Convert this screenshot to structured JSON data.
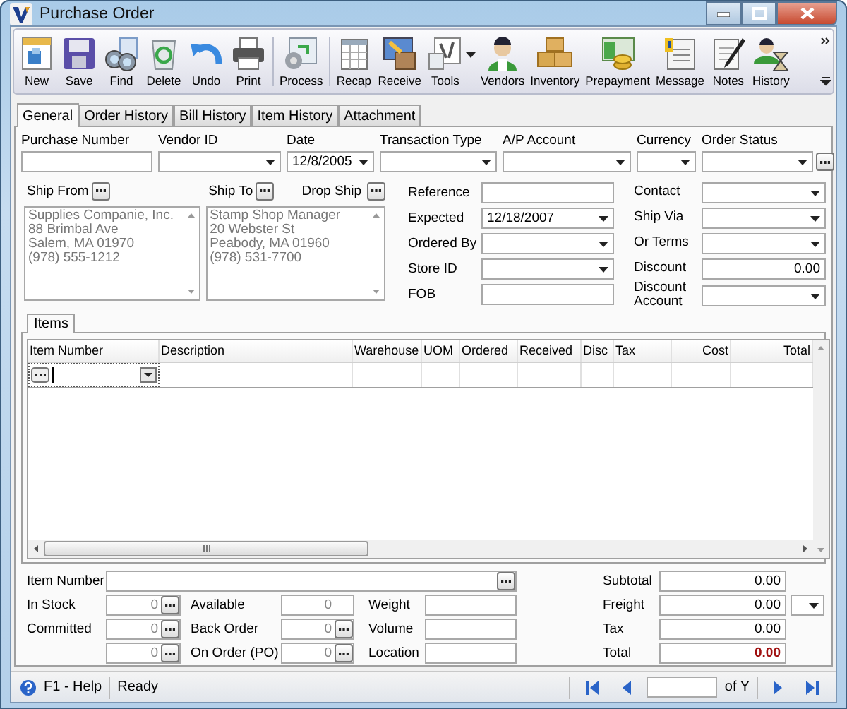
{
  "window": {
    "title": "Purchase Order"
  },
  "toolbar_groups": [
    [
      {
        "label": "New",
        "dropdown": false
      },
      {
        "label": "Save",
        "dropdown": false
      },
      {
        "label": "Find",
        "dropdown": false
      },
      {
        "label": "Delete",
        "dropdown": false
      },
      {
        "label": "Undo",
        "dropdown": false
      },
      {
        "label": "Print",
        "dropdown": false
      }
    ],
    [
      {
        "label": "Process",
        "dropdown": false
      }
    ],
    [
      {
        "label": "Recap",
        "dropdown": false
      },
      {
        "label": "Receive",
        "dropdown": false
      },
      {
        "label": "Tools",
        "dropdown": true
      },
      {
        "label": "Vendors",
        "dropdown": false
      },
      {
        "label": "Inventory",
        "dropdown": false
      },
      {
        "label": "Prepayment",
        "dropdown": false
      },
      {
        "label": "Message",
        "dropdown": false
      },
      {
        "label": "Notes",
        "dropdown": false
      },
      {
        "label": "History",
        "dropdown": false
      }
    ]
  ],
  "tabs": [
    {
      "label": "General",
      "selected": true
    },
    {
      "label": "Order History",
      "selected": false
    },
    {
      "label": "Bill History",
      "selected": false
    },
    {
      "label": "Item History",
      "selected": false
    },
    {
      "label": "Attachment",
      "selected": false
    }
  ],
  "header_fields": [
    {
      "label": "Purchase Number",
      "kind": "text"
    },
    {
      "label": "Vendor ID",
      "kind": "combo"
    },
    {
      "label": "Date",
      "kind": "combo",
      "value": "12/8/2005"
    },
    {
      "label": "Transaction Type",
      "kind": "combo"
    },
    {
      "label": "A/P Account",
      "kind": "combo"
    },
    {
      "label": "Currency",
      "kind": "combo"
    },
    {
      "label": "Order Status",
      "kind": "combo_more"
    }
  ],
  "ship_from": {
    "label": "Ship From",
    "lines": [
      "Supplies Companie, Inc.",
      "88 Brimbal Ave",
      "Salem, MA 01970",
      "(978) 555-1212"
    ]
  },
  "ship_to": {
    "label": "Ship To",
    "lines": [
      "Stamp Shop Manager",
      "20 Webster St",
      "Peabody, MA 01960",
      "(978) 531-7700"
    ]
  },
  "drop_ship": {
    "label": "Drop Ship"
  },
  "middle_fields": [
    {
      "label": "Reference",
      "kind": "text"
    },
    {
      "label": "Expected",
      "kind": "combo",
      "value": "12/18/2007"
    },
    {
      "label": "Ordered By",
      "kind": "combo"
    },
    {
      "label": "Store ID",
      "kind": "combo"
    },
    {
      "label": "FOB",
      "kind": "text"
    }
  ],
  "right_fields": [
    {
      "label": "Contact",
      "kind": "combo"
    },
    {
      "label": "Ship Via",
      "kind": "combo"
    },
    {
      "label": "Or Terms",
      "kind": "combo"
    },
    {
      "label": "Discount",
      "kind": "amount",
      "value": "0.00"
    },
    {
      "label": "Discount Account",
      "kind": "combo"
    }
  ],
  "items": {
    "tab": "Items",
    "columns": [
      "Item Number",
      "Description",
      "Warehouse",
      "UOM",
      "Ordered",
      "Received",
      "Disc",
      "Tax",
      "Cost",
      "Total"
    ]
  },
  "item_number": {
    "label": "Item Number"
  },
  "stock_fields": [
    [
      {
        "label": "In Stock",
        "kind": "count_more",
        "value": "0"
      },
      {
        "label": "Available",
        "kind": "count",
        "value": "0"
      },
      {
        "label": "Weight",
        "kind": "text"
      }
    ],
    [
      {
        "label": "Committed",
        "kind": "count_more",
        "value": "0"
      },
      {
        "label": "Back Order",
        "kind": "count_more",
        "value": "0"
      },
      {
        "label": "Volume",
        "kind": "text"
      }
    ],
    [
      {
        "kind": "count_more",
        "value": "0"
      },
      {
        "label": "On Order (PO)",
        "kind": "count_more",
        "value": "0"
      },
      {
        "label": "Location",
        "kind": "text"
      }
    ]
  ],
  "totals": [
    {
      "label": "Subtotal",
      "kind": "plain",
      "value": "0.00"
    },
    {
      "label": "Freight",
      "kind": "combo",
      "value": "0.00"
    },
    {
      "label": "Tax",
      "kind": "plain",
      "value": "0.00"
    },
    {
      "label": "Total",
      "kind": "grand",
      "value": "0.00"
    }
  ],
  "status_bar": {
    "help": "F1 - Help",
    "status": "Ready",
    "of": "of Y"
  }
}
